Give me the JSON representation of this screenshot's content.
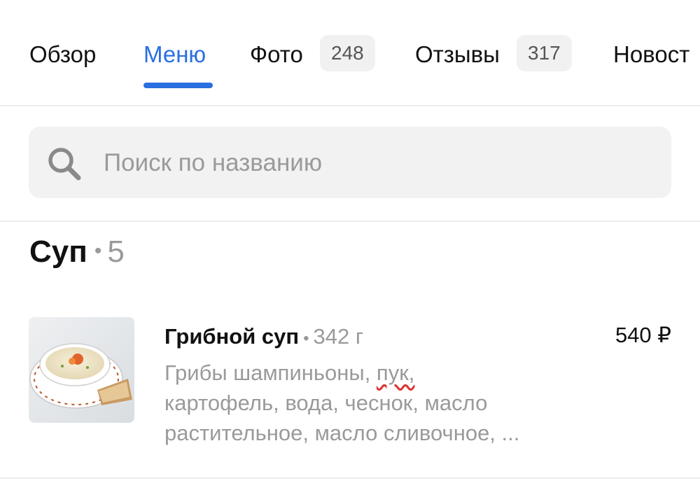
{
  "tabs": [
    {
      "label": "Обзор"
    },
    {
      "label": "Меню",
      "active": true
    },
    {
      "label": "Фото",
      "badge": "248"
    },
    {
      "label": "Отзывы",
      "badge": "317"
    },
    {
      "label": "Новост"
    }
  ],
  "search": {
    "placeholder": "Поиск по названию",
    "icon": "search-icon"
  },
  "section": {
    "title": "Суп",
    "count": "5"
  },
  "item": {
    "name": "Грибной суп",
    "weight": "342 г",
    "price": "540 ₽",
    "desc_part1": "Грибы шампиньоны, ",
    "desc_misspelled": "пук,",
    "desc_part2": "картофель, вода, чеснок, масло растительное, масло сливочное, ..."
  },
  "colors": {
    "accent": "#2a6fe0",
    "muted": "#9a9a9a",
    "badge_bg": "#f1f1f2",
    "search_bg": "#f2f2f3"
  }
}
